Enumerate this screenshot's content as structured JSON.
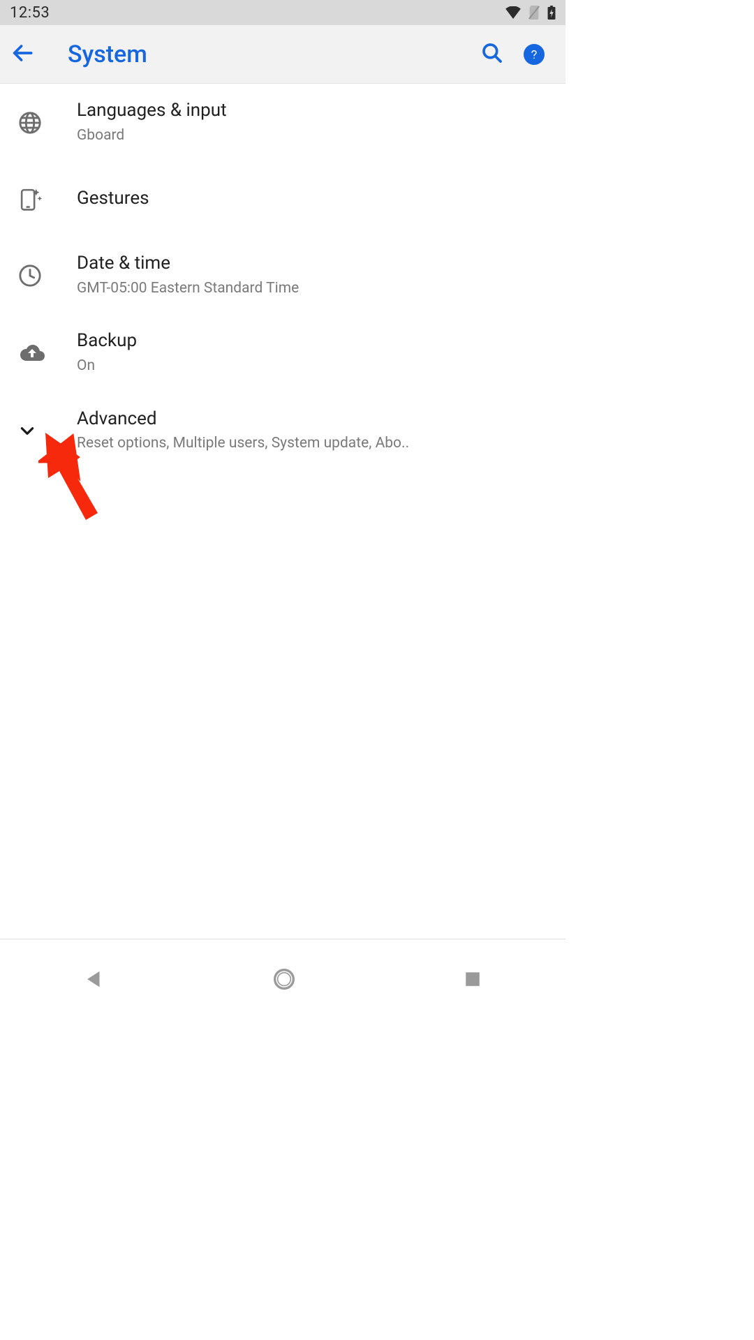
{
  "status_bar": {
    "time": "12:53"
  },
  "header": {
    "title": "System"
  },
  "items": [
    {
      "icon": "globe",
      "title": "Languages & input",
      "subtitle": "Gboard"
    },
    {
      "icon": "gesture",
      "title": "Gestures",
      "subtitle": ""
    },
    {
      "icon": "clock",
      "title": "Date & time",
      "subtitle": "GMT-05:00 Eastern Standard Time"
    },
    {
      "icon": "cloud",
      "title": "Backup",
      "subtitle": "On"
    },
    {
      "icon": "chevron",
      "title": "Advanced",
      "subtitle": "Reset options, Multiple users, System update, Abo.."
    }
  ]
}
